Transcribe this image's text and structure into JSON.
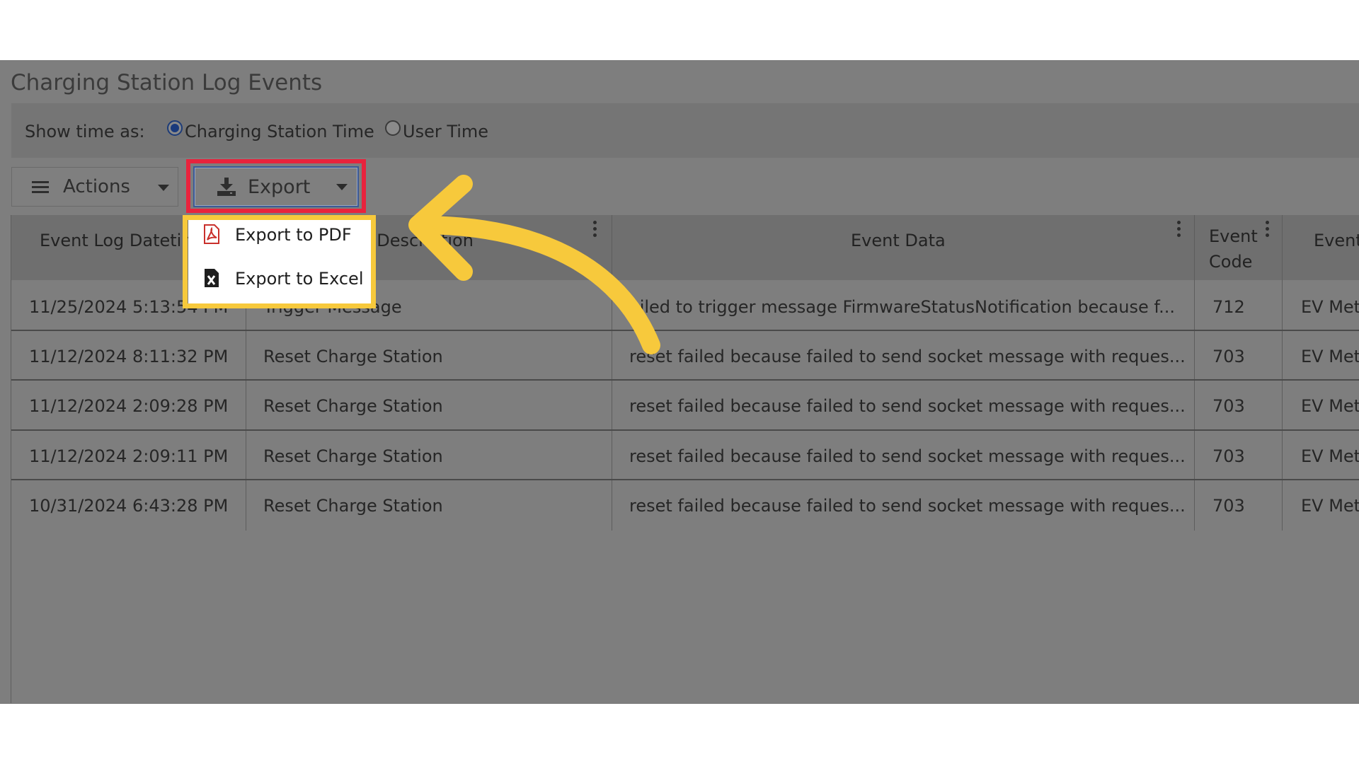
{
  "page": {
    "title": "Charging Station Log Events"
  },
  "time_options": {
    "label": "Show time as:",
    "options": [
      {
        "label": "Charging Station Time",
        "selected": true
      },
      {
        "label": "User Time",
        "selected": false
      }
    ]
  },
  "toolbar": {
    "actions_label": "Actions",
    "export_label": "Export"
  },
  "export_menu": {
    "items": [
      {
        "label": "Export to PDF",
        "icon": "pdf-icon"
      },
      {
        "label": "Export to Excel",
        "icon": "excel-icon"
      }
    ]
  },
  "table": {
    "columns": [
      "Event Log Datetim",
      "nt Description",
      "Event Data",
      "Event Code",
      "Event"
    ],
    "header_code_line1": "Event",
    "header_code_line2": "Code",
    "rows": [
      {
        "datetime": "11/25/2024 5:13:54 PM",
        "description": "Trigger Message",
        "data": "ailed to trigger message FirmwareStatusNotification because f...",
        "code": "712",
        "event": "EV Met"
      },
      {
        "datetime": "11/12/2024 8:11:32 PM",
        "description": "Reset Charge Station",
        "data": "reset failed because failed to send socket message with reques...",
        "code": "703",
        "event": "EV Met"
      },
      {
        "datetime": "11/12/2024 2:09:28 PM",
        "description": "Reset Charge Station",
        "data": "reset failed because failed to send socket message with reques...",
        "code": "703",
        "event": "EV Met"
      },
      {
        "datetime": "11/12/2024 2:09:11 PM",
        "description": "Reset Charge Station",
        "data": "reset failed because failed to send socket message with reques...",
        "code": "703",
        "event": "EV Met"
      },
      {
        "datetime": "10/31/2024 6:43:28 PM",
        "description": "Reset Charge Station",
        "data": "reset failed because failed to send socket message with reques...",
        "code": "703",
        "event": "EV Met"
      }
    ]
  },
  "colors": {
    "dim_background": "#7e7e7e",
    "export_highlight": "#e8233d",
    "menu_highlight": "#f7c93c",
    "arrow": "#f7c93c",
    "pdf_icon": "#c9302c"
  }
}
